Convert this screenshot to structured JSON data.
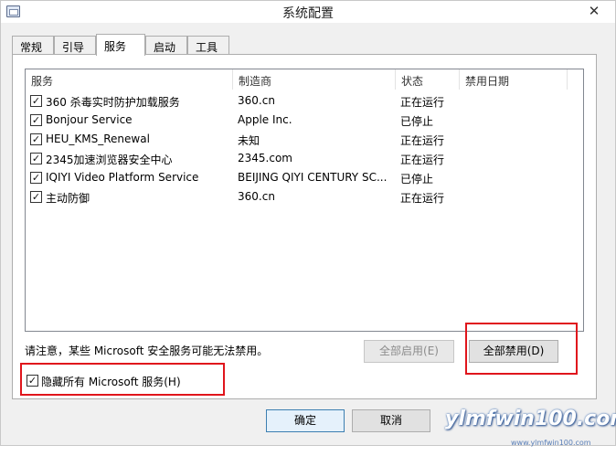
{
  "window": {
    "title": "系统配置",
    "close_glyph": "✕"
  },
  "tabs": [
    {
      "label": "常规"
    },
    {
      "label": "引导"
    },
    {
      "label": "服务",
      "active": true
    },
    {
      "label": "启动"
    },
    {
      "label": "工具"
    }
  ],
  "services": {
    "columns": [
      "服务",
      "制造商",
      "状态",
      "禁用日期"
    ],
    "rows": [
      {
        "checked": true,
        "name": "360 杀毒实时防护加载服务",
        "vendor": "360.cn",
        "status": "正在运行",
        "disabled_date": ""
      },
      {
        "checked": true,
        "name": "Bonjour Service",
        "vendor": "Apple Inc.",
        "status": "已停止",
        "disabled_date": ""
      },
      {
        "checked": true,
        "name": "HEU_KMS_Renewal",
        "vendor": "未知",
        "status": "正在运行",
        "disabled_date": ""
      },
      {
        "checked": true,
        "name": "2345加速浏览器安全中心",
        "vendor": "2345.com",
        "status": "正在运行",
        "disabled_date": ""
      },
      {
        "checked": true,
        "name": "IQIYI Video Platform Service",
        "vendor": "BEIJING QIYI CENTURY SC...",
        "status": "已停止",
        "disabled_date": ""
      },
      {
        "checked": true,
        "name": "主动防御",
        "vendor": "360.cn",
        "status": "正在运行",
        "disabled_date": ""
      }
    ]
  },
  "note": "请注意，某些 Microsoft 安全服务可能无法禁用。",
  "buttons": {
    "enable_all": "全部启用(E)",
    "disable_all": "全部禁用(D)",
    "ok": "确定",
    "cancel": "取消"
  },
  "hide_ms": {
    "checked": true,
    "label": "隐藏所有 Microsoft 服务(H)"
  },
  "checkmark_glyph": "✓",
  "watermark": {
    "text": "ylmfwin100.com",
    "sub": "www.ylmfwin100.com"
  },
  "colors": {
    "highlight_box": "#e0151c",
    "default_button_border": "#3c7fb1"
  }
}
